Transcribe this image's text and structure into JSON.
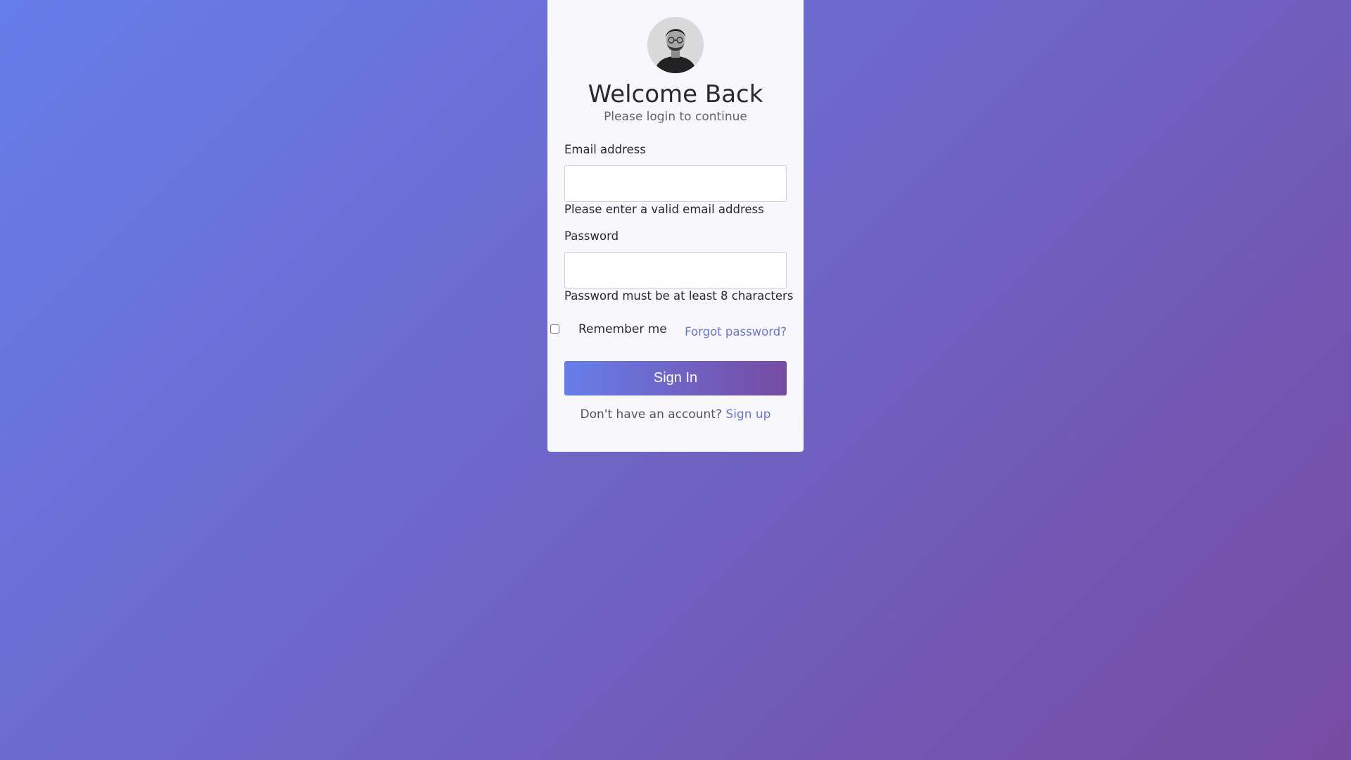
{
  "header": {
    "avatar_icon": "user-avatar-icon",
    "title": "Welcome Back",
    "subtitle": "Please login to continue"
  },
  "form": {
    "email": {
      "label": "Email address",
      "value": "",
      "placeholder": "",
      "help": "Please enter a valid email address"
    },
    "password": {
      "label": "Password",
      "value": "",
      "placeholder": "",
      "help": "Password must be at least 8 characters"
    },
    "remember_label": "Remember me",
    "remember_checked": false,
    "forgot_label": "Forgot password?",
    "submit_label": "Sign In"
  },
  "footer": {
    "prompt": "Don't have an account? ",
    "signup_label": "Sign up"
  },
  "colors": {
    "gradient_start": "#667eea",
    "gradient_end": "#764ba2",
    "link": "#6a75d8"
  }
}
